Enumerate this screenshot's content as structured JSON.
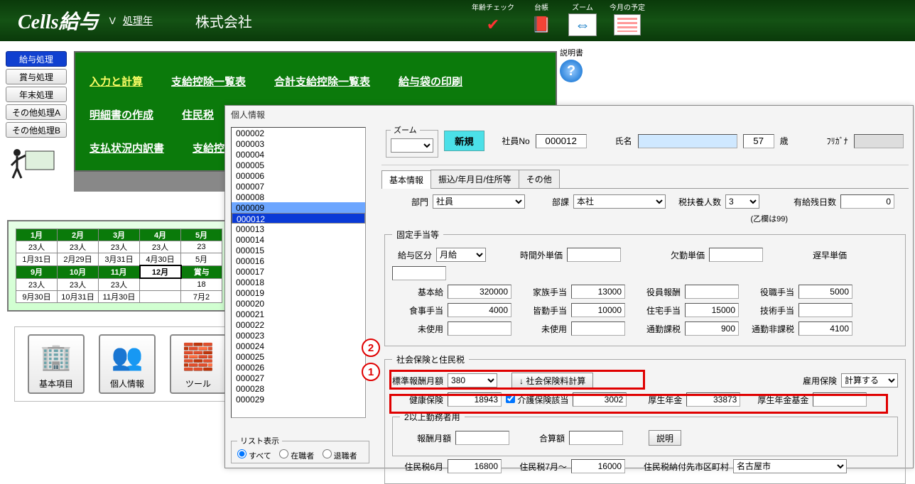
{
  "app": {
    "title": "Cells給与",
    "ver": "V",
    "proc_year_label": "処理年",
    "company_prefix": "株式会社"
  },
  "topicons": {
    "age": "年齢チェック",
    "ledger": "台帳",
    "zoom": "ズーム",
    "schedule": "今月の予定"
  },
  "help": {
    "label": "説明書"
  },
  "leftbtns": [
    "給与処理",
    "賞与処理",
    "年末処理",
    "その他処理A",
    "その他処理B"
  ],
  "nav": {
    "r1": [
      "入力と計算",
      "支給控除一覧表",
      "合計支給控除一覧表",
      "給与袋の印刷"
    ],
    "r2": [
      "明細書の作成",
      "住民税"
    ],
    "r3": [
      "支払状況内訳書",
      "支給控"
    ]
  },
  "cal": {
    "months1": [
      "1月",
      "2月",
      "3月",
      "4月",
      "5月"
    ],
    "ppl1": [
      "23人",
      "23人",
      "23人",
      "23人",
      "23"
    ],
    "dates1": [
      "1月31日",
      "2月29日",
      "3月31日",
      "4月30日",
      "5月"
    ],
    "months2": [
      "9月",
      "10月",
      "11月",
      "12月",
      "賞与"
    ],
    "ppl2": [
      "23人",
      "23人",
      "23人",
      "",
      "18"
    ],
    "dates2": [
      "9月30日",
      "10月31日",
      "11月30日",
      "",
      "7月2"
    ]
  },
  "iconbtns": [
    "基本項目",
    "個人情報",
    "ツール"
  ],
  "popup": {
    "title": "個人情報",
    "emp_ids": [
      "000002",
      "000003",
      "000004",
      "000005",
      "000006",
      "000007",
      "000008",
      "000009",
      "000012",
      "000013",
      "000014",
      "000015",
      "000016",
      "000017",
      "000018",
      "000019",
      "000020",
      "000021",
      "000022",
      "000023",
      "000024",
      "000025",
      "000026",
      "000027",
      "000028",
      "000029"
    ],
    "selected": "000012",
    "highlight": "000009",
    "filter": {
      "legend": "リスト表示",
      "all": "すべて",
      "active": "在職者",
      "retired": "退職者"
    },
    "zoom_legend": "ズーム",
    "new_btn": "新規",
    "empno_lbl": "社員No",
    "empno": "000012",
    "name_lbl": "氏名",
    "age": "57",
    "age_suffix": "歳",
    "furigana": "ﾌﾘｶﾞﾅ",
    "tabs": [
      "基本情報",
      "振込/年月日/住所等",
      "その他"
    ],
    "dept_lbl": "部門",
    "dept": "社員",
    "section_lbl": "部課",
    "section": "本社",
    "dep_num_lbl": "税扶養人数",
    "dep_num": "3",
    "otsu": "(乙欄は99)",
    "paid_leave_lbl": "有給残日数",
    "paid_leave": "0",
    "fixed_legend": "固定手当等",
    "paytype_lbl": "給与区分",
    "paytype": "月給",
    "ot_lbl": "時間外単価",
    "absent_lbl": "欠勤単価",
    "late_lbl": "遅早単価",
    "base_lbl": "基本給",
    "base": "320000",
    "family_lbl": "家族手当",
    "family": "13000",
    "officer_lbl": "役員報酬",
    "position_lbl": "役職手当",
    "position": "5000",
    "meal_lbl": "食事手当",
    "meal": "4000",
    "perfect_lbl": "皆勤手当",
    "perfect": "10000",
    "housing_lbl": "住宅手当",
    "housing": "15000",
    "tech_lbl": "技術手当",
    "unused_lbl": "未使用",
    "commute_tax_lbl": "通勤課税",
    "commute_tax": "900",
    "commute_notax_lbl": "通勤非課税",
    "commute_notax": "4100",
    "ins_legend": "社会保険と住民税",
    "std_lbl": "標準報酬月額",
    "std": "380",
    "calc_btn": "↓ 社会保険料計算",
    "emp_ins_lbl": "雇用保険",
    "emp_ins": "計算する",
    "health_lbl": "健康保険",
    "health": "18943",
    "care_chk": "介護保険該当",
    "care": "3002",
    "pension_lbl": "厚生年金",
    "pension": "33873",
    "fund_lbl": "厚生年金基金",
    "multi_legend": "2以上勤務者用",
    "rep_lbl": "報酬月額",
    "sum_lbl": "合算額",
    "explain": "説明",
    "rtax6_lbl": "住民税6月",
    "rtax6": "16800",
    "rtax7_lbl": "住民税7月～",
    "rtax7": "16000",
    "rtax_dest_lbl": "住民税納付先市区町村",
    "rtax_dest": "名古屋市"
  }
}
